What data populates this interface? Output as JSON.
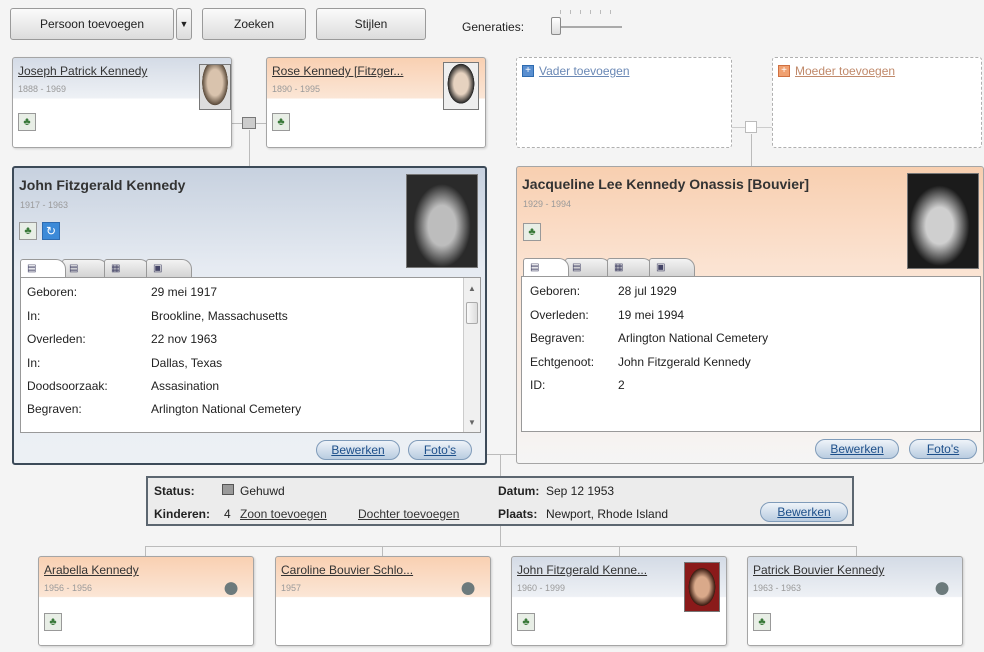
{
  "toolbar": {
    "add_person": "Persoon toevoegen",
    "search": "Zoeken",
    "styles": "Stijlen",
    "generations_label": "Generaties:"
  },
  "parents_row": {
    "father": {
      "name": "Joseph Patrick Kennedy",
      "dates": "1888 - 1969"
    },
    "mother": {
      "name": "Rose Kennedy [Fitzger...",
      "dates": "1890 - 1995"
    },
    "add_father": "Vader toevoegen",
    "add_mother": "Moeder toevoegen"
  },
  "main_person": {
    "name": "John Fitzgerald Kennedy",
    "dates": "1917 - 1963",
    "details": [
      {
        "label": "Geboren:",
        "value": "29 mei 1917"
      },
      {
        "label": "In:",
        "value": "Brookline, Massachusetts"
      },
      {
        "label": "Overleden:",
        "value": "22 nov 1963"
      },
      {
        "label": "In:",
        "value": "Dallas, Texas"
      },
      {
        "label": "Doodsoorzaak:",
        "value": "Assasination"
      },
      {
        "label": "Begraven:",
        "value": "Arlington National Cemetery"
      }
    ],
    "edit_button": "Bewerken",
    "photos_button": "Foto's"
  },
  "spouse": {
    "name": "Jacqueline Lee Kennedy Onassis [Bouvier]",
    "dates": "1929 - 1994",
    "details": [
      {
        "label": "Geboren:",
        "value": "28 jul 1929"
      },
      {
        "label": "Overleden:",
        "value": "19 mei 1994"
      },
      {
        "label": "Begraven:",
        "value": "Arlington National Cemetery"
      },
      {
        "label": "Echtgenoot:",
        "value": "John Fitzgerald Kennedy"
      },
      {
        "label": "ID:",
        "value": "2"
      }
    ],
    "edit_button": "Bewerken",
    "photos_button": "Foto's"
  },
  "marriage": {
    "status_label": "Status:",
    "status_value": "Gehuwd",
    "children_label": "Kinderen:",
    "children_count": "4",
    "add_son": "Zoon toevoegen",
    "add_daughter": "Dochter toevoegen",
    "date_label": "Datum:",
    "date_value": "Sep 12 1953",
    "place_label": "Plaats:",
    "place_value": "Newport, Rhode Island",
    "edit_button": "Bewerken"
  },
  "children": [
    {
      "name": "Arabella Kennedy",
      "dates": "1956 - 1956",
      "gender": "female"
    },
    {
      "name": "Caroline Bouvier Schlo...",
      "dates": "1957",
      "gender": "female"
    },
    {
      "name": "John Fitzgerald Kenne...",
      "dates": "1960 - 1999",
      "gender": "male"
    },
    {
      "name": "Patrick Bouvier Kennedy",
      "dates": "1963 - 1963",
      "gender": "male"
    }
  ],
  "colors": {
    "male_header": "#d4dbe6",
    "female_header": "#f9d0b2",
    "link_blue": "#1d4f8a"
  }
}
